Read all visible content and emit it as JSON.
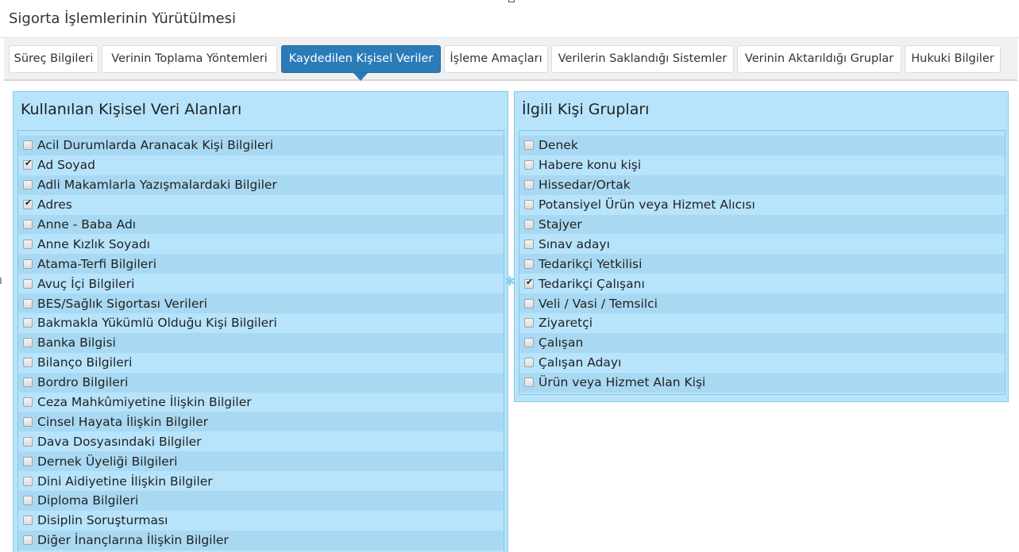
{
  "header": {
    "title": "Sigorta İşlemlerinin Yürütülmesi"
  },
  "tabs": [
    {
      "label": "Süreç Bilgileri",
      "active": false
    },
    {
      "label": "Verinin Toplama Yöntemleri",
      "active": false
    },
    {
      "label": "Kaydedilen Kişisel Veriler",
      "active": true
    },
    {
      "label": "İşleme Amaçları",
      "active": false
    },
    {
      "label": "Verilerin Saklandığı Sistemler",
      "active": false
    },
    {
      "label": "Verinin Aktarıldığı Gruplar",
      "active": false
    },
    {
      "label": "Hukuki Bilgiler",
      "active": false
    }
  ],
  "left_panel": {
    "title": "Kullanılan Kişisel Veri Alanları",
    "items": [
      {
        "label": "Acil Durumlarda Aranacak Kişi Bilgileri",
        "checked": false
      },
      {
        "label": "Ad Soyad",
        "checked": true
      },
      {
        "label": "Adli Makamlarla Yazışmalardaki Bilgiler",
        "checked": false
      },
      {
        "label": "Adres",
        "checked": true
      },
      {
        "label": "Anne - Baba Adı",
        "checked": false
      },
      {
        "label": "Anne Kızlık Soyadı",
        "checked": false
      },
      {
        "label": "Atama-Terfi Bilgileri",
        "checked": false
      },
      {
        "label": "Avuç İçi Bilgileri",
        "checked": false
      },
      {
        "label": "BES/Sağlık Sigortası Verileri",
        "checked": false
      },
      {
        "label": "Bakmakla Yükümlü Olduğu Kişi Bilgileri",
        "checked": false
      },
      {
        "label": "Banka Bilgisi",
        "checked": false
      },
      {
        "label": "Bilanço Bilgileri",
        "checked": false
      },
      {
        "label": "Bordro Bilgileri",
        "checked": false
      },
      {
        "label": "Ceza Mahkûmiyetine İlişkin Bilgiler",
        "checked": false
      },
      {
        "label": "Cinsel Hayata İlişkin Bilgiler",
        "checked": false
      },
      {
        "label": "Dava Dosyasındaki Bilgiler",
        "checked": false
      },
      {
        "label": "Dernek Üyeliği Bilgileri",
        "checked": false
      },
      {
        "label": "Dini Aidiyetine İlişkin Bilgiler",
        "checked": false
      },
      {
        "label": "Diploma Bilgileri",
        "checked": false
      },
      {
        "label": "Disiplin Soruşturması",
        "checked": false
      },
      {
        "label": "Diğer İnançlarına İlişkin Bilgiler",
        "checked": false
      }
    ]
  },
  "right_panel": {
    "title": "İlgili Kişi Grupları",
    "items": [
      {
        "label": "Denek",
        "checked": false
      },
      {
        "label": "Habere konu kişi",
        "checked": false
      },
      {
        "label": "Hissedar/Ortak",
        "checked": false
      },
      {
        "label": "Potansiyel Ürün veya Hizmet Alıcısı",
        "checked": false
      },
      {
        "label": "Stajyer",
        "checked": false
      },
      {
        "label": "Sınav adayı",
        "checked": false
      },
      {
        "label": "Tedarikçi Yetkilisi",
        "checked": false
      },
      {
        "label": "Tedarikçi Çalışanı",
        "checked": true
      },
      {
        "label": "Veli / Vasi / Temsilci",
        "checked": false
      },
      {
        "label": "Ziyaretçi",
        "checked": false
      },
      {
        "label": "Çalışan",
        "checked": false
      },
      {
        "label": "Çalışan Adayı",
        "checked": false
      },
      {
        "label": "Ürün veya Hizmet Alan Kişi",
        "checked": false
      }
    ]
  },
  "colors": {
    "active_tab": "#2b7bb9",
    "panel_bg": "#b7e4fb",
    "row_alt_bg": "#a9d9f2"
  }
}
